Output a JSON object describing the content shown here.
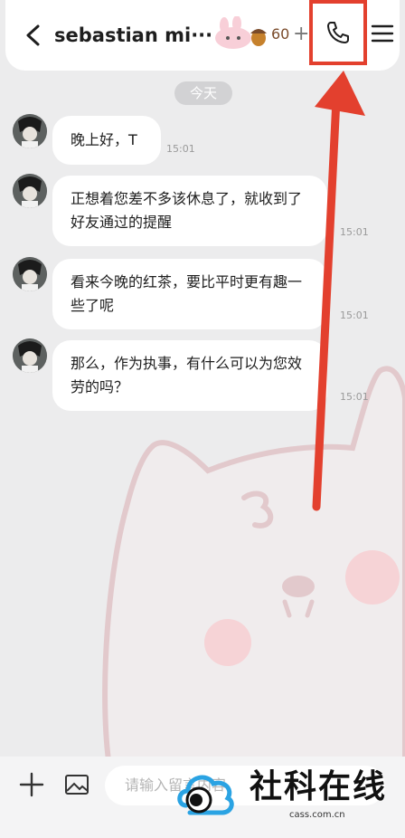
{
  "header": {
    "contact_name": "sebastian mi···",
    "points": "60",
    "plus_label": "+"
  },
  "date_divider": "今天",
  "messages": [
    {
      "text": "晚上好，T",
      "time": "15:01"
    },
    {
      "text": "正想着您差不多该休息了，就收到了好友通过的提醒",
      "time": "15:01"
    },
    {
      "text": "看来今晚的红茶，要比平时更有趣一些了呢",
      "time": "15:01"
    },
    {
      "text": "那么，作为执事，有什么可以为您效劳的吗？",
      "time": "15:01"
    }
  ],
  "input": {
    "placeholder": "请输入留言内容"
  },
  "watermark": {
    "title": "社科在线",
    "subtitle": "cass.com.cn"
  },
  "colors": {
    "annotation_red": "#e3402e",
    "background": "#ececed",
    "bubble": "#ffffff",
    "illustration_line": "#e2c9cc",
    "illustration_cheek": "#f6d3d6"
  },
  "icons": [
    "back-arrow-icon",
    "bunny-icon",
    "acorn-icon",
    "plus-icon",
    "phone-icon",
    "menu-icon",
    "add-icon",
    "image-icon"
  ]
}
